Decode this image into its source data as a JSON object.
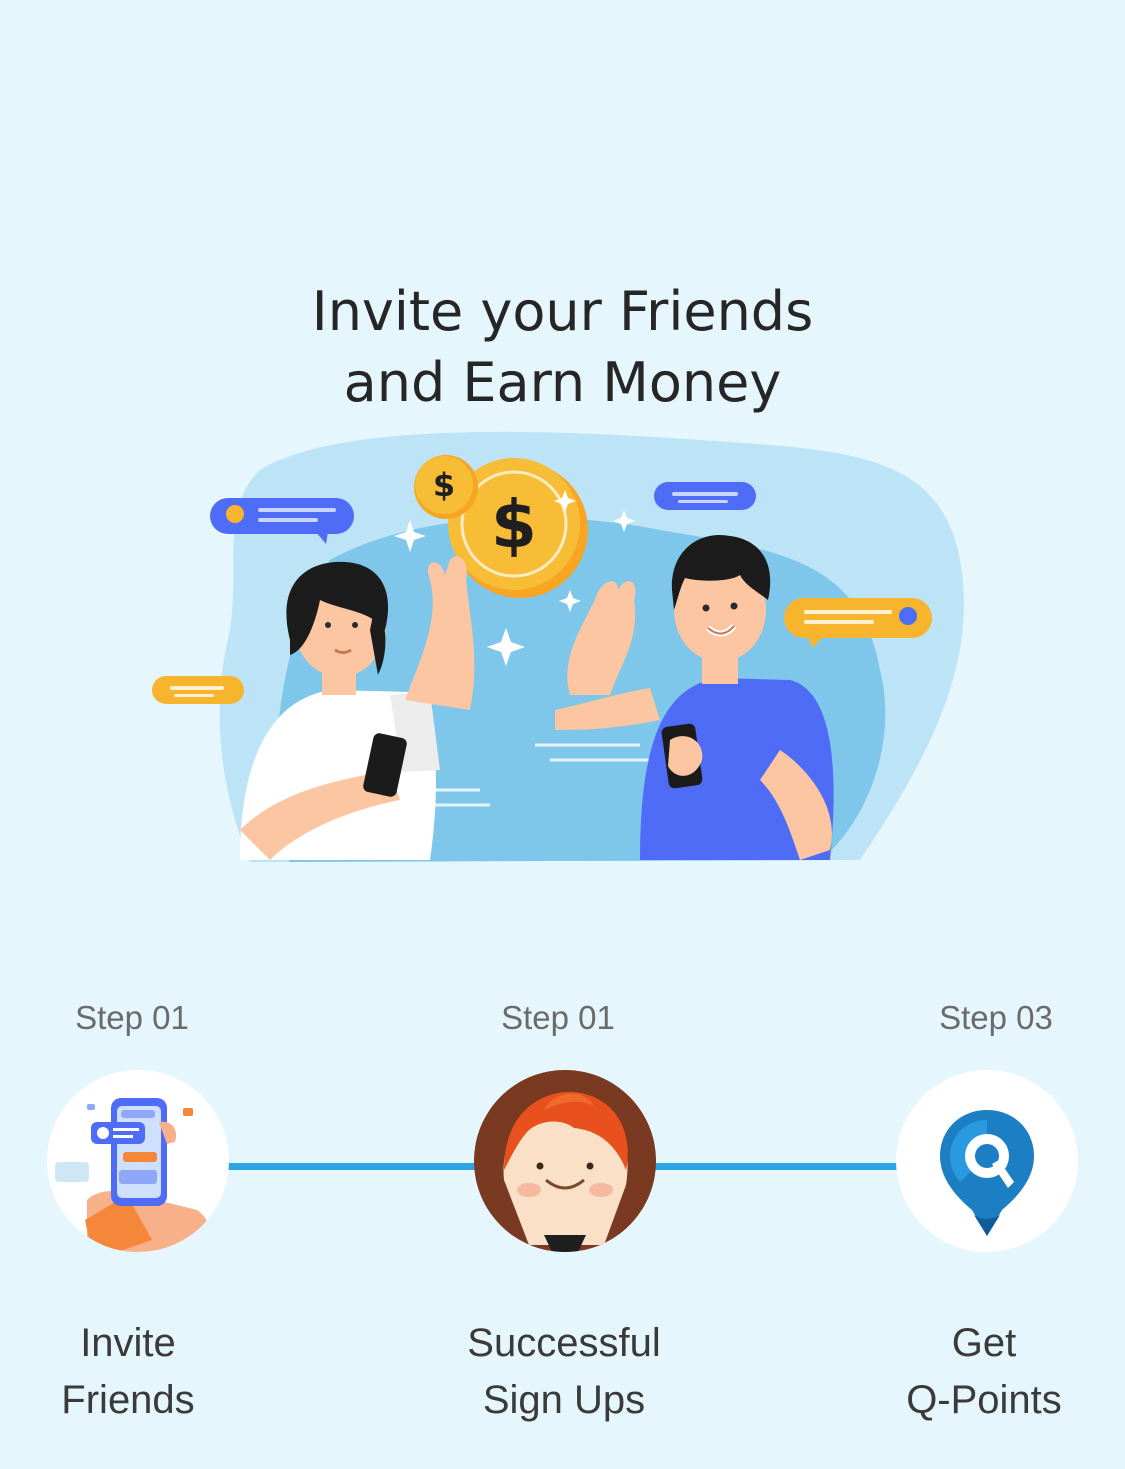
{
  "headline": {
    "line1": "Invite your Friends",
    "line2": "and Earn Money"
  },
  "hero": {
    "icon": "friends-high-five-illustration",
    "coin_symbol": "$"
  },
  "steps": [
    {
      "label": "Step 01",
      "title_line1": "Invite",
      "title_line2": "Friends",
      "icon": "phone-chat-icon"
    },
    {
      "label": "Step 01",
      "title_line1": "Successful",
      "title_line2": "Sign Ups",
      "icon": "smiling-avatar-icon"
    },
    {
      "label": "Step 03",
      "title_line1": "Get",
      "title_line2": "Q-Points",
      "icon": "q-points-pin-icon"
    }
  ],
  "colors": {
    "background": "#e6f6fd",
    "connector": "#2ea3e6",
    "accent_blue": "#4e6cf6",
    "accent_yellow": "#f7b52d",
    "brand_q": "#1c7fc4"
  }
}
